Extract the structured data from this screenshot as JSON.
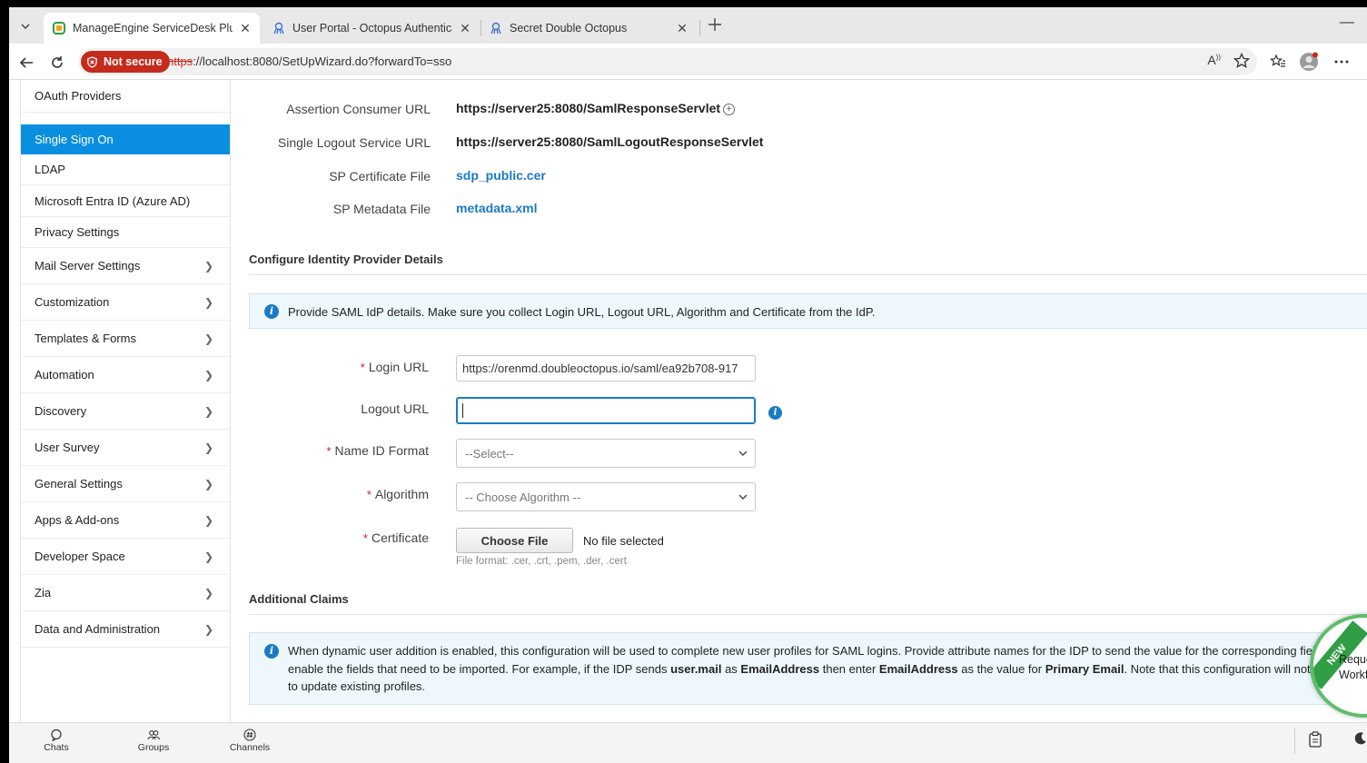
{
  "browser": {
    "tabs": [
      {
        "title": "ManageEngine ServiceDesk Plus"
      },
      {
        "title": "User Portal - Octopus Authenticator"
      },
      {
        "title": "Secret Double Octopus"
      }
    ],
    "security_label": "Not secure",
    "url_scheme": "https",
    "url_rest": "://localhost:8080/SetUpWizard.do?forwardTo=sso"
  },
  "sidebar": {
    "items": [
      {
        "label": "OAuth Providers"
      },
      {
        "label": "Single Sign On"
      },
      {
        "label": "LDAP"
      },
      {
        "label": "Microsoft Entra ID (Azure AD)"
      },
      {
        "label": "Privacy Settings"
      },
      {
        "label": "Mail Server Settings"
      },
      {
        "label": "Customization"
      },
      {
        "label": "Templates & Forms"
      },
      {
        "label": "Automation"
      },
      {
        "label": "Discovery"
      },
      {
        "label": "User Survey"
      },
      {
        "label": "General Settings"
      },
      {
        "label": "Apps & Add-ons"
      },
      {
        "label": "Developer Space"
      },
      {
        "label": "Zia"
      },
      {
        "label": "Data and Administration"
      }
    ]
  },
  "sp_details": {
    "acs_label": "Assertion Consumer URL",
    "acs_value": "https://server25:8080/SamlResponseServlet",
    "slo_label": "Single Logout Service URL",
    "slo_value": "https://server25:8080/SamlLogoutResponseServlet",
    "cert_label": "SP Certificate File",
    "cert_value": "sdp_public.cer",
    "meta_label": "SP Metadata File",
    "meta_value": "metadata.xml"
  },
  "idp": {
    "section_title": "Configure Identity Provider Details",
    "note": "Provide SAML IdP details. Make sure you collect Login URL, Logout URL, Algorithm and Certificate from the IdP.",
    "login_label": "Login URL",
    "login_value": "https://orenmd.doubleoctopus.io/saml/ea92b708-917",
    "logout_label": "Logout URL",
    "logout_value": "",
    "nameid_label": "Name ID Format",
    "nameid_value": "--Select--",
    "algo_label": "Algorithm",
    "algo_value": "-- Choose Algorithm --",
    "cert_label": "Certificate",
    "choose_file": "Choose File",
    "no_file": "No file selected",
    "file_hint": "File format: .cer, .crt, .pem, .der, .cert",
    "required_mark": "*"
  },
  "claims": {
    "section_title": "Additional Claims",
    "note_a": "When dynamic user addition is enabled, this configuration will be used to complete new user profiles for SAML logins. Provide attribute names for the IDP to send the value for the corresponding field and enable the fields that need to be imported. For example, if the IDP sends ",
    "note_b": "user.mail",
    "note_c": " as ",
    "note_d": "EmailAddress",
    "note_e": " then enter ",
    "note_f": "EmailAddress",
    "note_g": " as the value for ",
    "note_h": "Primary Email",
    "note_i": ". Note that this configuration will not be used to update existing profiles."
  },
  "badge": {
    "ribbon": "NEW",
    "line1": "Request",
    "line2": "Workflow"
  },
  "bottom": {
    "chats": "Chats",
    "groups": "Groups",
    "channels": "Channels"
  },
  "colors": {
    "accent": "#0a8fe0",
    "link": "#1a7bc4",
    "danger": "#c42b1c"
  }
}
